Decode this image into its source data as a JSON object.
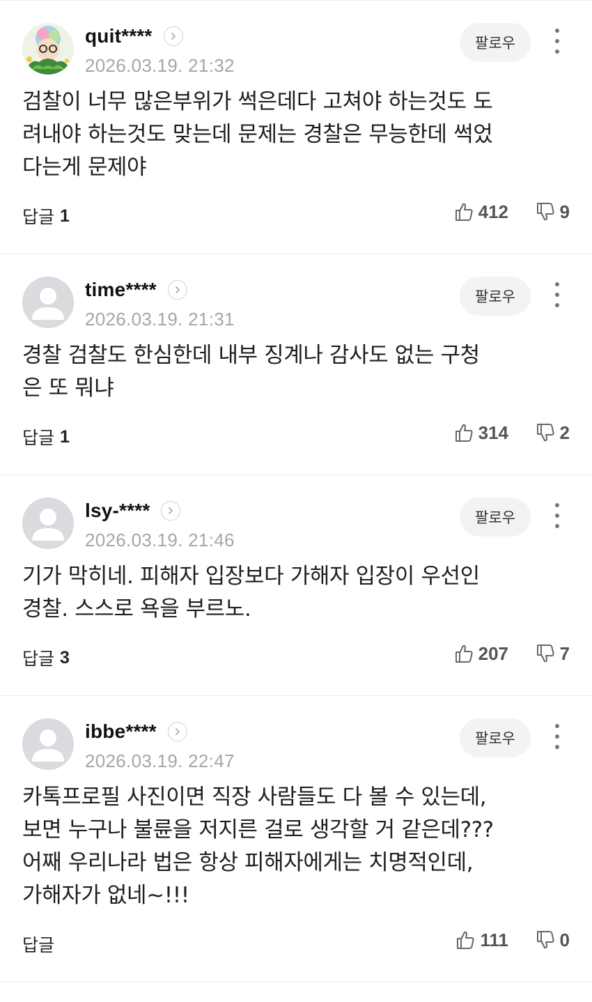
{
  "follow_label": "팔로우",
  "reply_label": "답글",
  "comments": [
    {
      "nickname": "quit****",
      "timestamp": "2026.03.19. 21:32",
      "avatar": "custom-profile-image",
      "lines": [
        "검찰이 너무 많은부위가 썩은데다 고쳐야 하는것도 도",
        "려내야 하는것도 맞는데 문제는 경찰은 무능한데 썩었",
        "다는게 문제야"
      ],
      "reply_count": "1",
      "likes": "412",
      "dislikes": "9"
    },
    {
      "nickname": "time****",
      "timestamp": "2026.03.19. 21:31",
      "avatar": "default-user-icon",
      "lines": [
        "경찰 검찰도 한심한데 내부 징계나 감사도 없는 구청",
        "은 또 뭐냐"
      ],
      "reply_count": "1",
      "likes": "314",
      "dislikes": "2"
    },
    {
      "nickname": "lsy-****",
      "timestamp": "2026.03.19. 21:46",
      "avatar": "default-user-icon",
      "lines": [
        "기가 막히네. 피해자 입장보다 가해자 입장이 우선인",
        "경찰. 스스로 욕을 부르노."
      ],
      "reply_count": "3",
      "likes": "207",
      "dislikes": "7"
    },
    {
      "nickname": "ibbe****",
      "timestamp": "2026.03.19. 22:47",
      "avatar": "default-user-icon",
      "lines": [
        "카톡프로필 사진이면 직장 사람들도 다 볼 수 있는데,",
        "보면 누구나 불륜을 저지른 걸로 생각할 거 같은데???",
        "어째 우리나라 법은 항상 피해자에게는 치명적인데,",
        "가해자가 없네~!!!"
      ],
      "reply_count": "",
      "likes": "111",
      "dislikes": "0"
    }
  ]
}
